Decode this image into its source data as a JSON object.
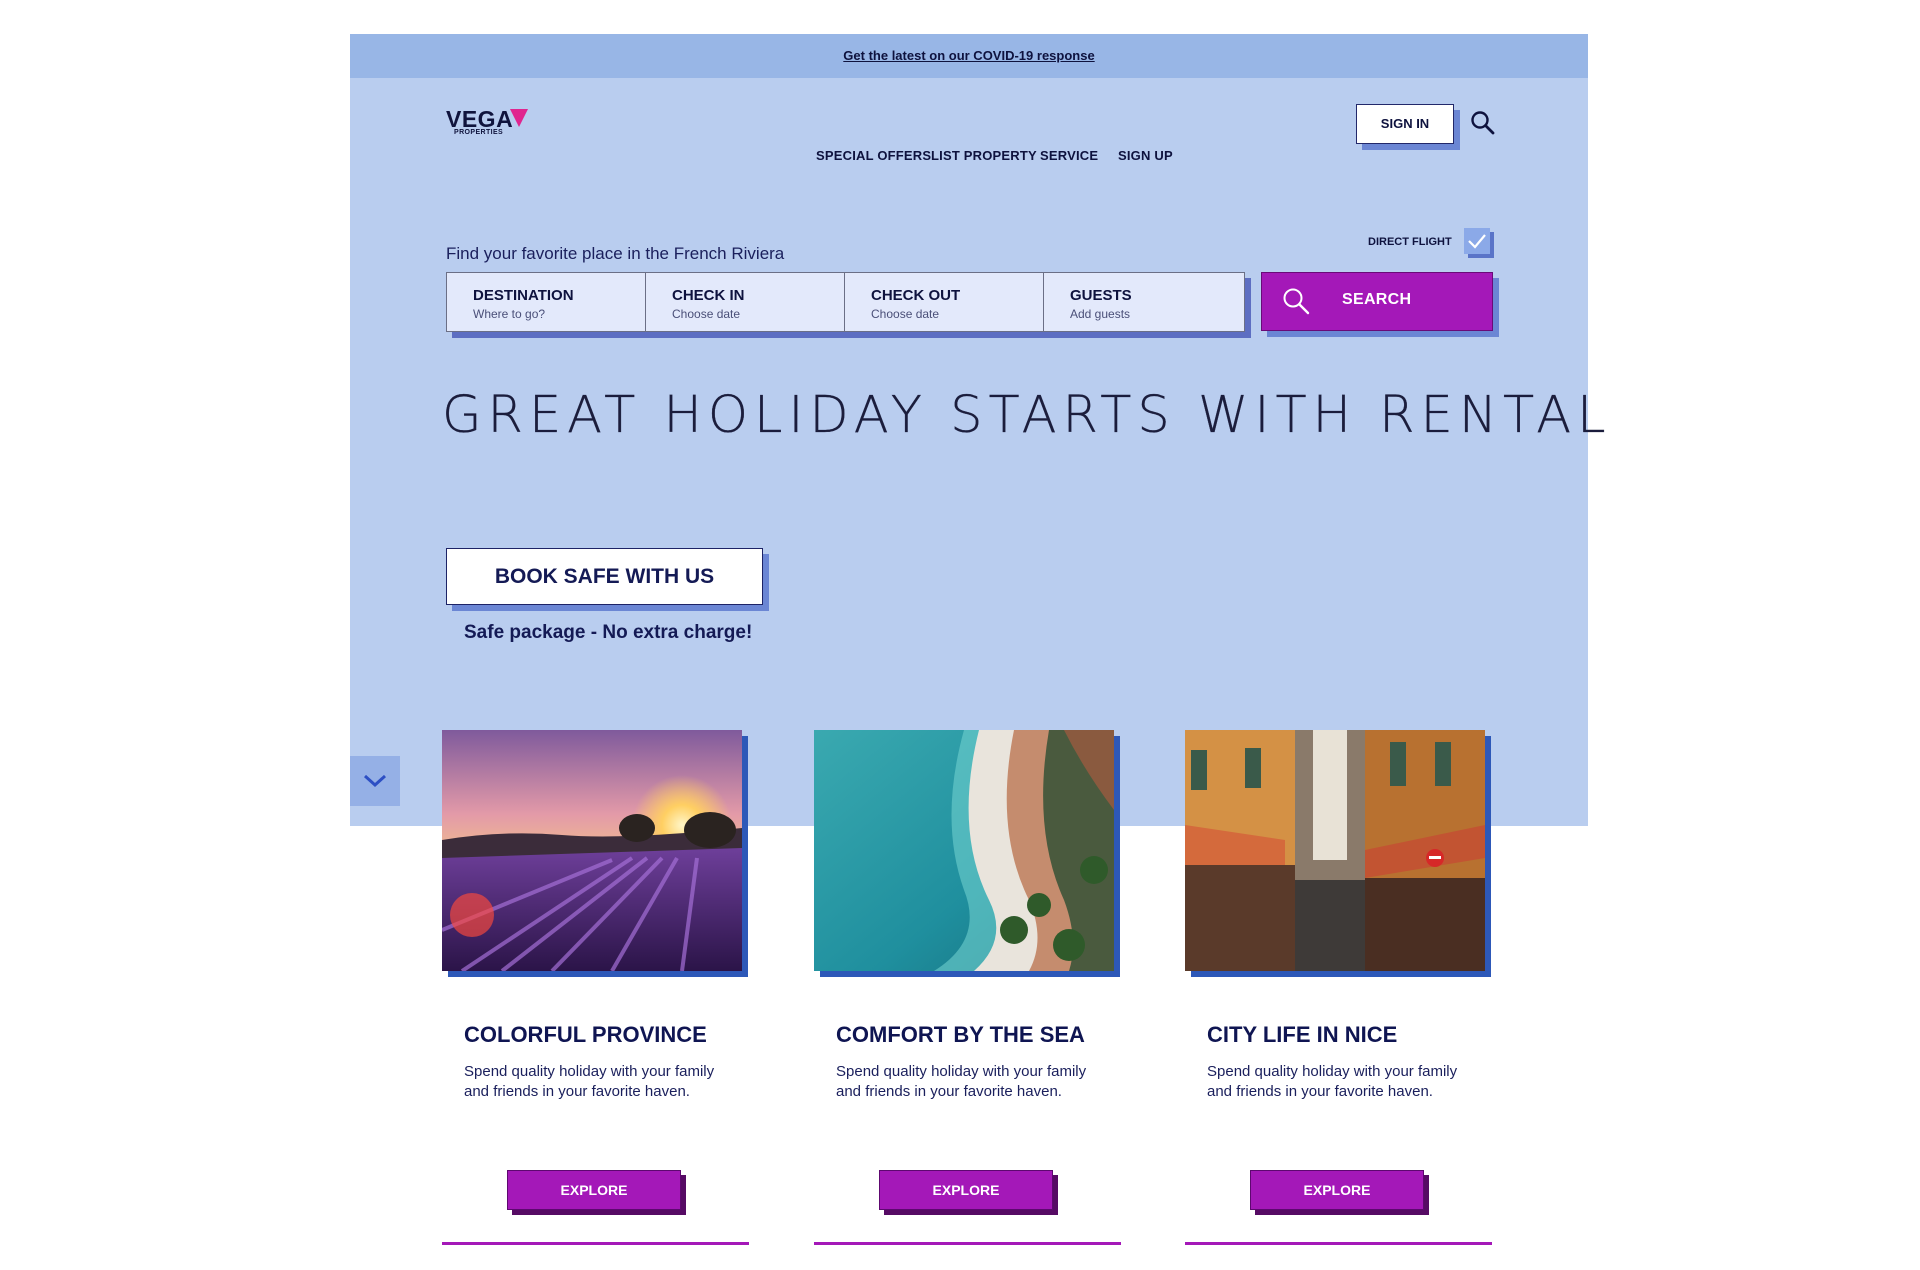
{
  "announcement": {
    "text": "Get the latest on our COVID-19 response"
  },
  "logo": {
    "word": "VEGA",
    "sub": "PROPERTIES"
  },
  "nav": {
    "items": [
      "SPECIAL OFFERS",
      "LIST PROPERTY",
      "SERVICE",
      "SIGN UP"
    ],
    "sign_in": "SIGN IN",
    "search_icon": "search-icon"
  },
  "search": {
    "intro": "Find your favorite place in the French Riviera",
    "direct_flight": {
      "label": "DIRECT FLIGHT",
      "checked": true
    },
    "fields": [
      {
        "label": "DESTINATION",
        "placeholder": "Where to go?"
      },
      {
        "label": "CHECK IN",
        "placeholder": "Choose date"
      },
      {
        "label": "CHECK OUT",
        "placeholder": "Choose date"
      },
      {
        "label": "GUESTS",
        "placeholder": "Add guests"
      }
    ],
    "button": "SEARCH"
  },
  "hero": {
    "headline": "GREAT HOLIDAY STARTS WITH RENTAL",
    "cta": "BOOK SAFE WITH US",
    "cta_note": "Safe package - No extra charge!"
  },
  "cards": [
    {
      "title": "COLORFUL PROVINCE",
      "description": "Spend quality holiday with your family and friends in your favorite haven.",
      "button": "EXPLORE"
    },
    {
      "title": "COMFORT BY THE SEA",
      "description": "Spend quality holiday with your family and friends in your favorite haven.",
      "button": "EXPLORE"
    },
    {
      "title": "CITY LIFE IN NICE",
      "description": "Spend quality holiday with your family and friends in your favorite haven.",
      "button": "EXPLORE"
    }
  ],
  "colors": {
    "hero_bg": "#b9cdef",
    "topbar_bg": "#98b6e6",
    "accent_purple": "#a418b8",
    "shadow_blue": "#6b86d4",
    "brand_pink": "#e0258f",
    "text_navy": "#0f1552"
  }
}
